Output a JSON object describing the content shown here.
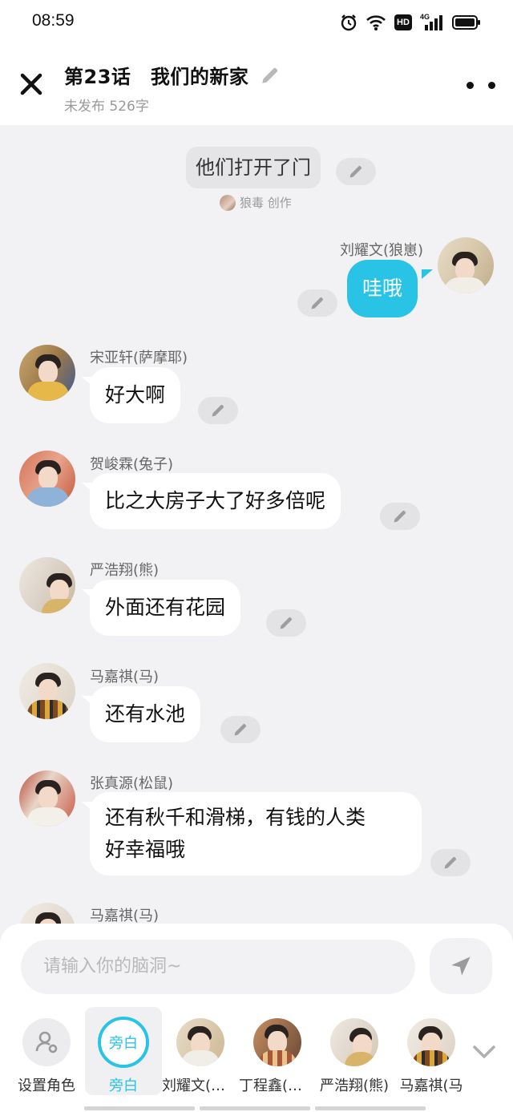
{
  "status_bar": {
    "time": "08:59",
    "hd_label": "HD",
    "net_label": "4G"
  },
  "header": {
    "title": "第23话　我们的新家",
    "subtitle": "未发布 526字"
  },
  "chat": {
    "narration": {
      "text": "他们打开了门",
      "author_label": "狼毒 创作"
    },
    "messages": [
      {
        "side": "right",
        "name": "刘耀文(狼崽)",
        "text": "哇哦"
      },
      {
        "side": "left",
        "name": "宋亚轩(萨摩耶)",
        "text": "好大啊"
      },
      {
        "side": "left",
        "name": "贺峻霖(兔子)",
        "text": "比之大房子大了好多倍呢"
      },
      {
        "side": "left",
        "name": "严浩翔(熊)",
        "text": "外面还有花园"
      },
      {
        "side": "left",
        "name": "马嘉祺(马)",
        "text": "还有水池"
      },
      {
        "side": "left",
        "name": "张真源(松鼠)",
        "text_line1": "还有秋千和滑梯，有钱的人类",
        "text_line2": "好幸福哦"
      },
      {
        "side": "left",
        "name": "马嘉祺(马)"
      }
    ]
  },
  "composer": {
    "placeholder": "请输入你的脑洞~"
  },
  "roles": [
    {
      "label": "设置角色",
      "icon": "role-settings-icon"
    },
    {
      "label": "旁白",
      "ring_text": "旁白",
      "active": true
    },
    {
      "label": "刘耀文(狼…"
    },
    {
      "label": "丁程鑫(狐…"
    },
    {
      "label": "严浩翔(熊)"
    },
    {
      "label": "马嘉祺(马"
    }
  ],
  "colors": {
    "accent": "#29c3e6",
    "bubble_right": "#29c3e6",
    "background": "#f2f2f4"
  }
}
